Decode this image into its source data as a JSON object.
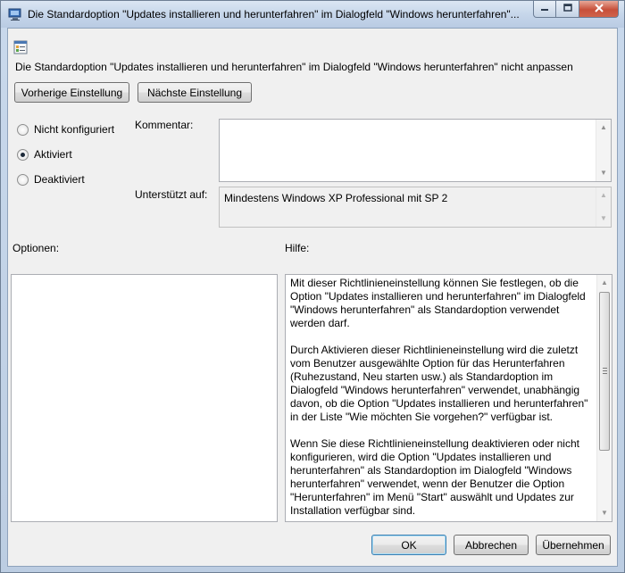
{
  "window": {
    "title": "Die Standardoption \"Updates installieren und herunterfahren\" im Dialogfeld \"Windows herunterfahren\"..."
  },
  "policy": {
    "name": "Die Standardoption \"Updates installieren und herunterfahren\" im Dialogfeld \"Windows herunterfahren\" nicht anpassen"
  },
  "nav": {
    "prev_label": "Vorherige Einstellung",
    "next_label": "Nächste Einstellung"
  },
  "state": {
    "options": [
      {
        "label": "Nicht konfiguriert",
        "checked": false
      },
      {
        "label": "Aktiviert",
        "checked": true
      },
      {
        "label": "Deaktiviert",
        "checked": false
      }
    ]
  },
  "comment": {
    "label": "Kommentar:",
    "value": ""
  },
  "supported": {
    "label": "Unterstützt auf:",
    "value": "Mindestens Windows XP Professional mit SP 2"
  },
  "options_section": {
    "label": "Optionen:"
  },
  "help": {
    "label": "Hilfe:",
    "paragraphs": [
      "Mit dieser Richtlinieneinstellung können Sie festlegen, ob die Option \"Updates installieren und herunterfahren\" im Dialogfeld \"Windows herunterfahren\" als Standardoption verwendet werden darf.",
      "Durch Aktivieren dieser Richtlinieneinstellung wird die zuletzt vom Benutzer ausgewählte Option für das Herunterfahren (Ruhezustand, Neu starten usw.) als Standardoption im Dialogfeld \"Windows herunterfahren\" verwendet, unabhängig davon, ob die Option \"Updates installieren und herunterfahren\" in der Liste \"Wie möchten Sie vorgehen?\" verfügbar ist.",
      "Wenn Sie diese Richtlinieneinstellung deaktivieren oder nicht konfigurieren, wird die Option \"Updates installieren und herunterfahren\" als Standardoption im Dialogfeld \"Windows herunterfahren\" verwendet, wenn der Benutzer die Option \"Herunterfahren\" im Menü \"Start\" auswählt und Updates zur Installation verfügbar sind."
    ]
  },
  "footer": {
    "ok_label": "OK",
    "cancel_label": "Abbrechen",
    "apply_label": "Übernehmen"
  }
}
